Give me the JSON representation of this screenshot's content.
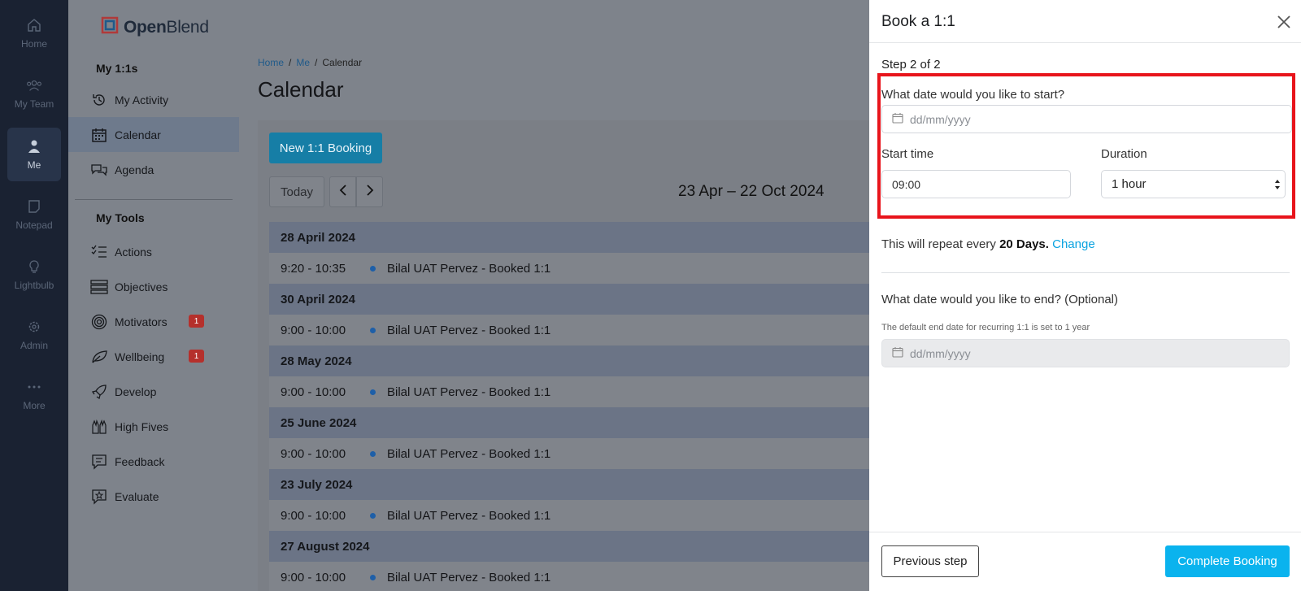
{
  "rail": {
    "items": [
      {
        "label": "Home",
        "icon": "home-icon"
      },
      {
        "label": "My Team",
        "icon": "team-icon"
      },
      {
        "label": "Me",
        "icon": "person-icon"
      },
      {
        "label": "Notepad",
        "icon": "notepad-icon"
      },
      {
        "label": "Lightbulb",
        "icon": "lightbulb-icon"
      },
      {
        "label": "Admin",
        "icon": "gear-icon"
      },
      {
        "label": "More",
        "icon": "more-icon"
      }
    ]
  },
  "sidebar": {
    "brand_prefix": "Open",
    "brand_suffix": "Blend",
    "section1": "My 1:1s",
    "items1": [
      {
        "label": "My Activity",
        "icon": "history-icon"
      },
      {
        "label": "Calendar",
        "icon": "calendar-icon"
      },
      {
        "label": "Agenda",
        "icon": "chat-icon"
      }
    ],
    "section2": "My Tools",
    "items2": [
      {
        "label": "Actions",
        "icon": "checklist-icon"
      },
      {
        "label": "Objectives",
        "icon": "objectives-icon"
      },
      {
        "label": "Motivators",
        "icon": "target-icon",
        "badge": "1"
      },
      {
        "label": "Wellbeing",
        "icon": "leaf-icon",
        "badge": "1"
      },
      {
        "label": "Develop",
        "icon": "rocket-icon"
      },
      {
        "label": "High Fives",
        "icon": "high-five-icon"
      },
      {
        "label": "Feedback",
        "icon": "feedback-icon"
      },
      {
        "label": "Evaluate",
        "icon": "star-icon"
      }
    ]
  },
  "main": {
    "breadcrumb": {
      "home": "Home",
      "sep": "/",
      "me": "Me",
      "current": "Calendar"
    },
    "title": "Calendar",
    "new_booking": "New 1:1 Booking",
    "today": "Today",
    "range": "23 Apr – 22 Oct 2024",
    "agenda": [
      {
        "date": "28 April 2024",
        "time": "9:20 - 10:35",
        "event": "Bilal UAT Pervez - Booked 1:1"
      },
      {
        "date": "30 April 2024",
        "time": "9:00 - 10:00",
        "event": "Bilal UAT Pervez - Booked 1:1"
      },
      {
        "date": "28 May 2024",
        "time": "9:00 - 10:00",
        "event": "Bilal UAT Pervez - Booked 1:1"
      },
      {
        "date": "25 June 2024",
        "time": "9:00 - 10:00",
        "event": "Bilal UAT Pervez - Booked 1:1"
      },
      {
        "date": "23 July 2024",
        "time": "9:00 - 10:00",
        "event": "Bilal UAT Pervez - Booked 1:1"
      },
      {
        "date": "27 August 2024",
        "time": "9:00 - 10:00",
        "event": "Bilal UAT Pervez - Booked 1:1"
      }
    ]
  },
  "modal": {
    "title": "Book a 1:1",
    "step": "Step 2 of 2",
    "start_date_label": "What date would you like to start?",
    "start_date_placeholder": "dd/mm/yyyy",
    "start_time_label": "Start time",
    "start_time_value": "09:00",
    "duration_label": "Duration",
    "duration_value": "1 hour",
    "repeat_prefix": "This will repeat every",
    "repeat_value": "20 Days.",
    "repeat_change": "Change",
    "end_date_label": "What date would you like to end? (Optional)",
    "end_date_help": "The default end date for recurring 1:1 is set to 1 year",
    "end_date_placeholder": "dd/mm/yyyy",
    "prev_button": "Previous step",
    "complete_button": "Complete Booking"
  },
  "colors": {
    "accent": "#0ab3ee",
    "highlight": "#e8141b",
    "badge": "#b5302c"
  }
}
